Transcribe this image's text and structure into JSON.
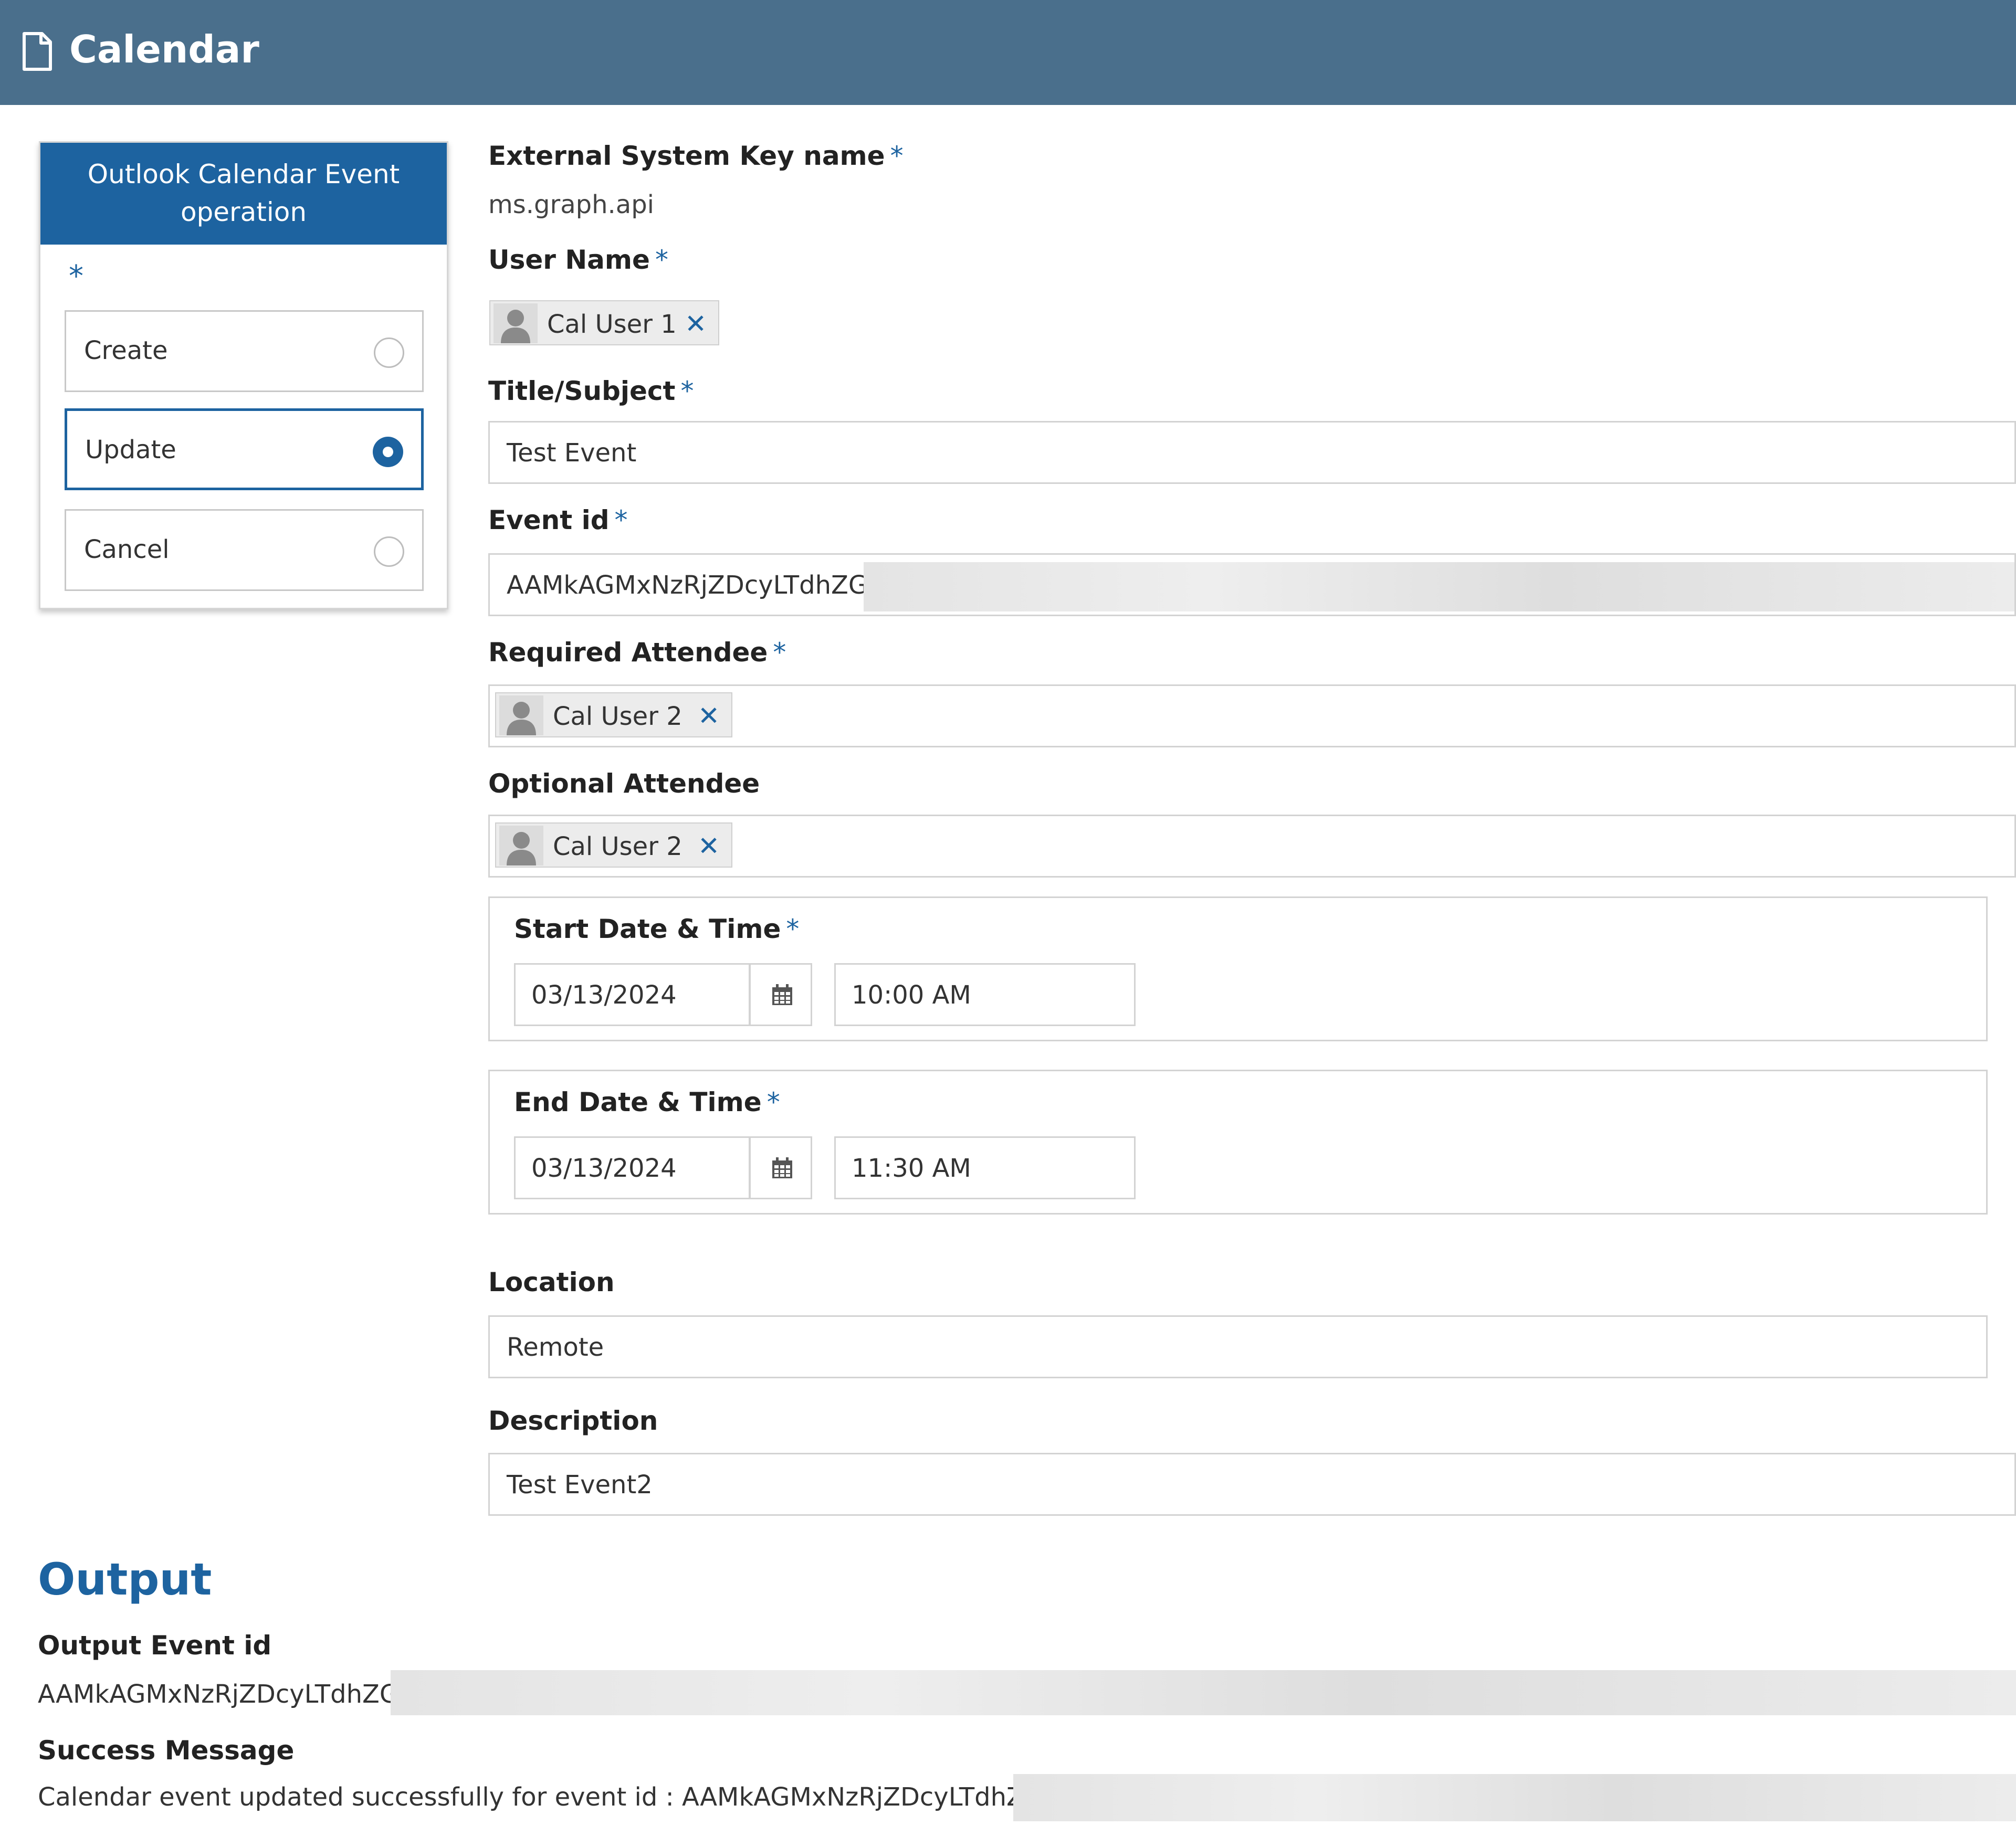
{
  "header": {
    "title": "Calendar",
    "icon": "document-icon",
    "bg_color": "#4a6f8c"
  },
  "operation_panel": {
    "title": "Outlook Calendar Event operation",
    "required_marker": "*",
    "options": [
      {
        "label": "Create",
        "selected": false
      },
      {
        "label": "Update",
        "selected": true
      },
      {
        "label": "Cancel",
        "selected": false
      }
    ],
    "accent_color": "#1d63a0"
  },
  "form": {
    "required_marker": "*",
    "external_key": {
      "label": "External System Key name",
      "value": "ms.graph.api"
    },
    "user_name": {
      "label": "User Name",
      "chip": "Cal User 1"
    },
    "title_subject": {
      "label": "Title/Subject",
      "value": "Test Event"
    },
    "event_id": {
      "label": "Event id",
      "value": "AAMkAGMxNzRjZDcyLTdhZG"
    },
    "required_attendee": {
      "label": "Required Attendee",
      "chip": "Cal User 2"
    },
    "optional_attendee": {
      "label": "Optional Attendee",
      "chip": "Cal User 2"
    },
    "start": {
      "label": "Start Date & Time",
      "date": "03/13/2024",
      "time": "10:00 AM"
    },
    "end": {
      "label": "End Date & Time",
      "date": "03/13/2024",
      "time": "11:30 AM"
    },
    "location": {
      "label": "Location",
      "value": "Remote"
    },
    "description": {
      "label": "Description",
      "value": "Test Event2"
    }
  },
  "output": {
    "heading": "Output",
    "event_id_label": "Output Event id",
    "event_id_value": "AAMkAGMxNzRjZDcyLTdhZG",
    "success_label": "Success Message",
    "success_value": "Calendar event updated successfully for event id :  AAMkAGMxNzRjZDcyLTdhZG"
  }
}
